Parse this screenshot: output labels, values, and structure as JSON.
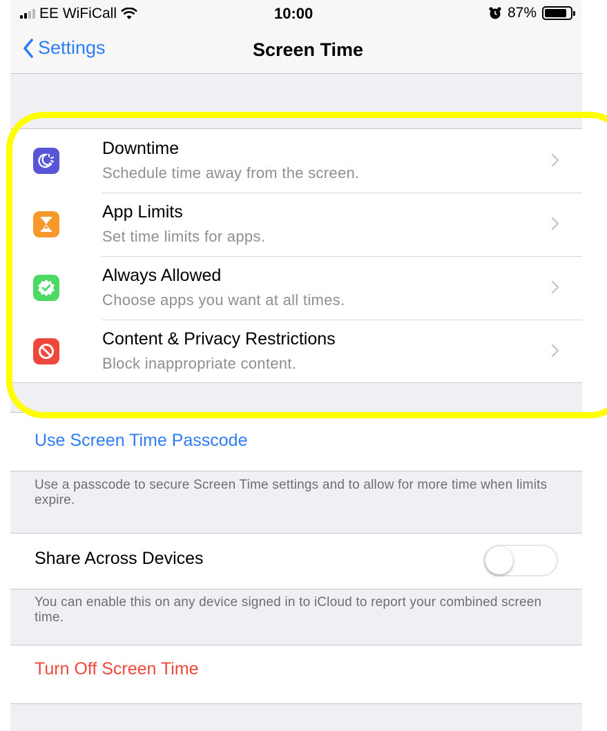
{
  "status_bar": {
    "carrier": "EE WiFiCall",
    "time": "10:00",
    "battery_percent": "87%",
    "battery_level": 0.87,
    "icons": [
      "signal-icon",
      "wifi-icon",
      "alarm-icon",
      "battery-icon"
    ]
  },
  "nav": {
    "back_label": "Settings",
    "title": "Screen Time"
  },
  "menu": [
    {
      "title": "Downtime",
      "subtitle": "Schedule time away from the screen.",
      "icon": "downtime-icon",
      "color": "#5856d6"
    },
    {
      "title": "App Limits",
      "subtitle": "Set time limits for apps.",
      "icon": "hourglass-icon",
      "color": "#f7982a"
    },
    {
      "title": "Always Allowed",
      "subtitle": "Choose apps you want at all times.",
      "icon": "checkmark-badge-icon",
      "color": "#4cd964"
    },
    {
      "title": "Content & Privacy Restrictions",
      "subtitle": "Block inappropriate content.",
      "icon": "restriction-icon",
      "color": "#ff3b30"
    }
  ],
  "passcode": {
    "label": "Use Screen Time Passcode",
    "footer": "Use a passcode to secure Screen Time settings and to allow for more time when limits expire."
  },
  "share": {
    "label": "Share Across Devices",
    "enabled": false,
    "footer": "You can enable this on any device signed in to iCloud to report your combined screen time."
  },
  "turn_off": {
    "label": "Turn Off Screen Time"
  },
  "colors": {
    "accent_blue": "#2f7cf6",
    "destructive_red": "#f0473c",
    "highlight_yellow": "#ffff00"
  }
}
